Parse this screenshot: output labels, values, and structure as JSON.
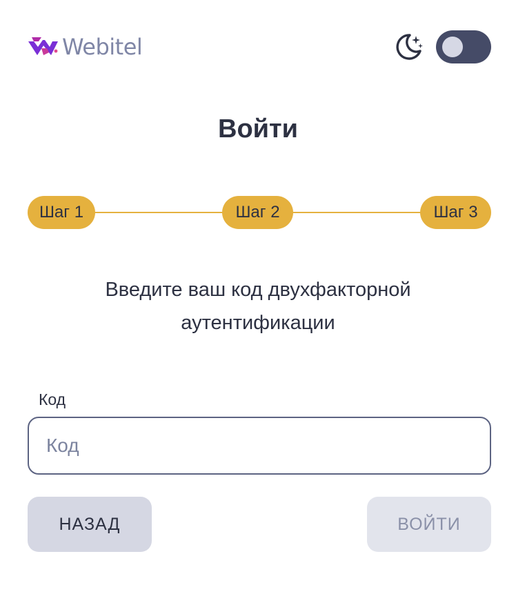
{
  "header": {
    "logo_text": "Webitel",
    "theme_icon": "moon-stars-icon",
    "theme_toggle_on": false
  },
  "login": {
    "title": "Войти",
    "steps": [
      {
        "label": "Шаг 1"
      },
      {
        "label": "Шаг 2"
      },
      {
        "label": "Шаг 3"
      }
    ],
    "instruction": "Введите ваш код двухфакторной аутентификации",
    "code_field": {
      "label": "Код",
      "placeholder": "Код",
      "value": ""
    },
    "back_label": "НАЗАД",
    "submit_label": "ВОЙТИ"
  },
  "colors": {
    "accent": "#e5b13e",
    "text": "#2d3142",
    "toggle_bg": "#454b67",
    "logo_text": "#7f86a6",
    "back_button_bg": "#d5d7e3",
    "disabled_button_bg": "#e2e4ec"
  }
}
